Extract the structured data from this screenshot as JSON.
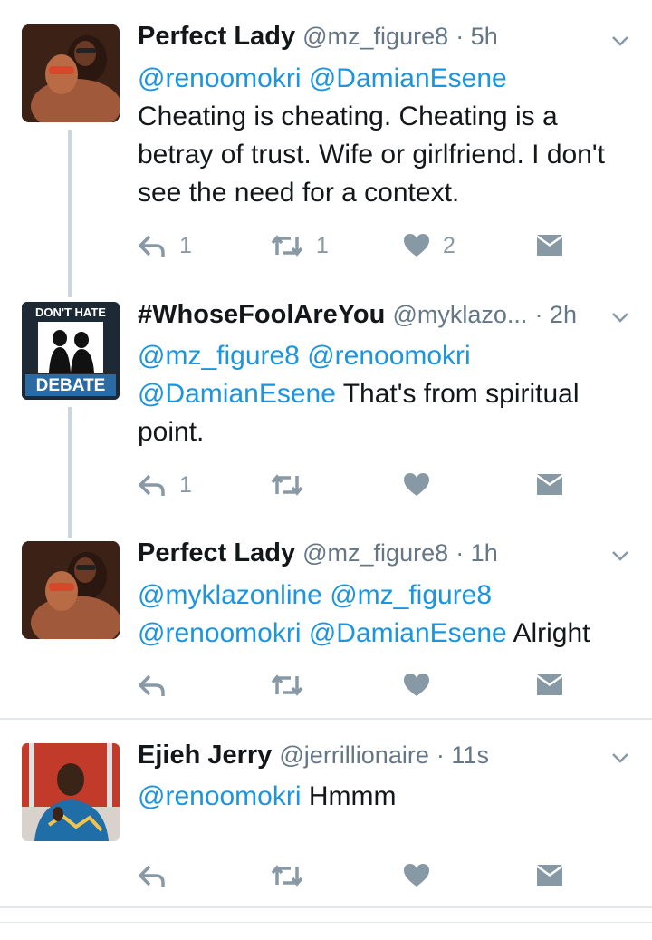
{
  "tweets": [
    {
      "name": "Perfect Lady",
      "handle": "@mz_figure8",
      "time": "· 5h",
      "mentions": "@renoomokri @DamianEsene",
      "text": "Cheating is cheating. Cheating is a betray of trust. Wife or girlfriend. I don't see the need for a context.",
      "reply_count": "1",
      "retweet_count": "1",
      "like_count": "2"
    },
    {
      "name": "#WhoseFoolAreYou",
      "handle": "@myklazo...",
      "time": "· 2h",
      "mentions_line1": "@mz_figure8 @renoomokri",
      "mentions_line2": "@DamianEsene",
      "text_after": "That's from spiritual",
      "text_line3": "point.",
      "reply_count": "1",
      "avatar_top": "DON'T HATE",
      "avatar_bottom": "DEBATE"
    },
    {
      "name": "Perfect Lady",
      "handle": "@mz_figure8",
      "time": "· 1h",
      "mentions_line1": "@myklazonline @mz_figure8",
      "mentions_line2": "@renoomokri @DamianEsene",
      "text_after": "Alright"
    },
    {
      "name": "Ejieh Jerry",
      "handle": "@jerrillionaire",
      "time": "· 11s",
      "mentions": "@renoomokri",
      "text_after": "Hmmm"
    }
  ],
  "icons": [
    "reply-icon",
    "retweet-icon",
    "like-icon",
    "direct-message-icon",
    "chevron-down-icon"
  ],
  "colors": {
    "link": "#1b95e0",
    "muted": "#8899a6",
    "thread_line": "#ccd6dd"
  }
}
